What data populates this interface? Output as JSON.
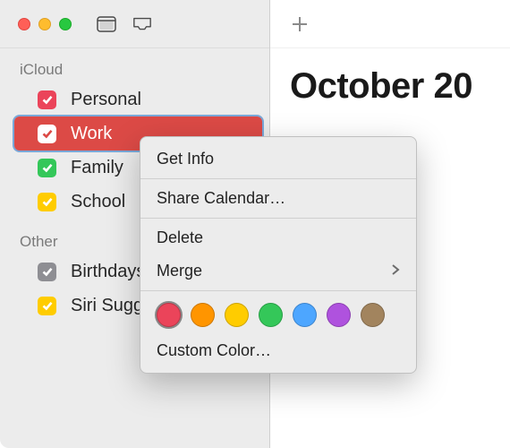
{
  "sidebar": {
    "groups": [
      {
        "label": "iCloud",
        "items": [
          {
            "label": "Personal",
            "color": "#eb445a",
            "selected": false
          },
          {
            "label": "Work",
            "color": "#ffffff",
            "selected": true
          },
          {
            "label": "Family",
            "color": "#34c759",
            "selected": false
          },
          {
            "label": "School",
            "color": "#ffcc00",
            "selected": false
          }
        ]
      },
      {
        "label": "Other",
        "items": [
          {
            "label": "Birthdays",
            "color": "#8e8e93",
            "selected": false
          },
          {
            "label": "Siri Suggestions",
            "color": "#ffcc00",
            "selected": false
          }
        ]
      }
    ]
  },
  "main": {
    "month_title": "October 20"
  },
  "context_menu": {
    "items": {
      "get_info": "Get Info",
      "share": "Share Calendar…",
      "delete": "Delete",
      "merge": "Merge",
      "custom_color": "Custom Color…"
    },
    "colors": [
      {
        "hex": "#eb445a",
        "selected": true
      },
      {
        "hex": "#ff9500",
        "selected": false
      },
      {
        "hex": "#ffcc00",
        "selected": false
      },
      {
        "hex": "#34c759",
        "selected": false
      },
      {
        "hex": "#4da6ff",
        "selected": false
      },
      {
        "hex": "#af52de",
        "selected": false
      },
      {
        "hex": "#a2845e",
        "selected": false
      }
    ]
  }
}
